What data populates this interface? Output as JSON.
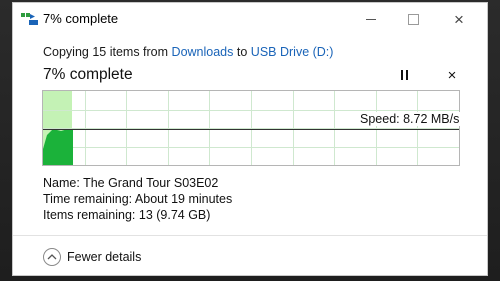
{
  "window": {
    "title": "7% complete",
    "controls": {
      "minimize": "minimize",
      "maximize": "maximize",
      "close": "×"
    }
  },
  "copy": {
    "prefix": "Copying 15 items from",
    "source": "Downloads",
    "middle": "to",
    "destination": "USB Drive (D:)"
  },
  "progress": {
    "title": "7% complete",
    "percent": 7,
    "speed_label": "Speed: 8.72 MB/s",
    "cancel": "×"
  },
  "details": {
    "name": "Name:  The Grand Tour S03E02",
    "time_remaining": "Time remaining:  About 19 minutes",
    "items_remaining": "Items remaining:  13 (9.74 GB)"
  },
  "footer": {
    "fewer_details": "Fewer details"
  },
  "colors": {
    "accent_link": "#1a64b8",
    "progress_fill": "#c4f2b5",
    "speed_fill": "#1bb23a",
    "grid": "#cfe8cf"
  },
  "icons": {
    "title": "copy-arrow-icon",
    "pause": "pause-icon",
    "cancel": "close-icon",
    "fewer": "chevron-up-icon"
  }
}
